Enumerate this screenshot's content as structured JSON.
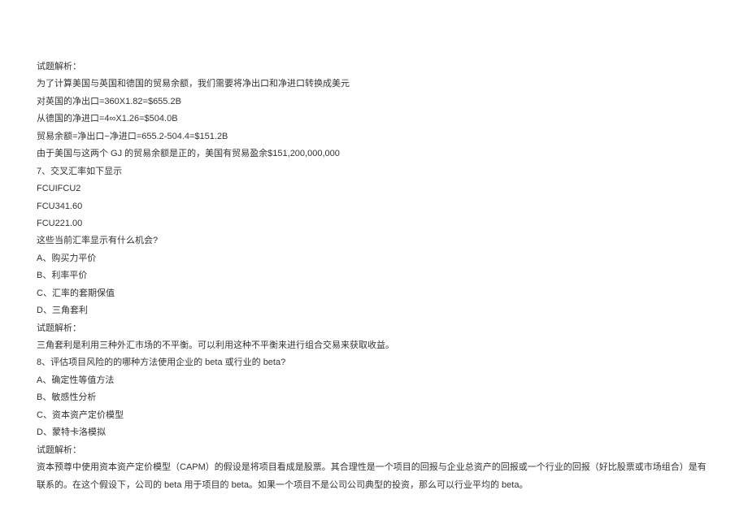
{
  "lines": [
    "试题解析：",
    "为了计算美国与英国和德国的贸易余额，我们需要将净出口和净进口转换成美元",
    "对英国的净出口=360X1.82=$655.2B",
    "从德国的净进口=4∞X1.26=$504.0B",
    "贸易余额=净出口−净进口=655.2-504.4=$151.2B",
    "由于美国与这两个 GJ 的贸易余额是正的，美国有贸易盈余$151,200,000,000",
    "7、交叉汇率如下显示",
    "FCUIFCU2",
    "FCU341.60",
    "FCU221.00",
    "这些当前汇率显示有什么机会?",
    "A、购买力平价",
    "B、利率平价",
    "C、汇率的套期保值",
    "D、三角套利",
    "试题解析：",
    "三角套利是利用三种外汇市场的不平衡。可以利用这种不平衡来进行组合交易来获取收益。",
    "8、评估项目风险的的哪种方法使用企业的 beta 或行业的 beta?",
    "A、确定性等值方法",
    "B、敏感性分析",
    "C、资本资产定价模型",
    "D、蒙特卡洛模拟",
    "试题解析：",
    "资本预尊中使用资本资产定价模型（CAPM）的假设是将项目看成是股票。其合理性是一个项目的回报与企业总资产的回报或一个行业的回报（好比股票或市场组合）是有联系的。在这个假设下，公司的 beta 用于项目的 beta。如果一个项目不是公司公司典型的投资，那么可以行业平均的 beta。"
  ]
}
